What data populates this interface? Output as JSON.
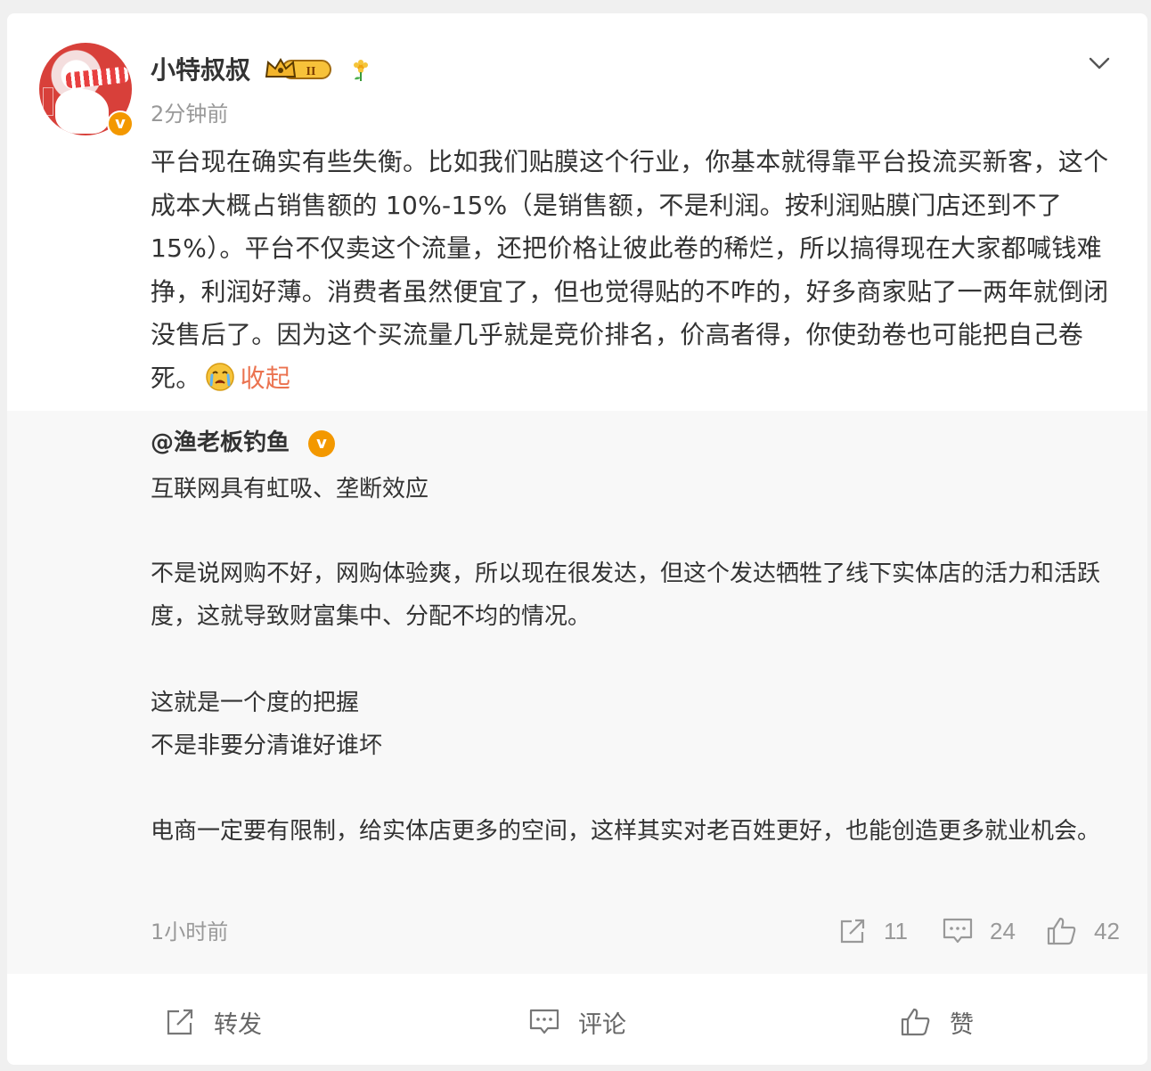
{
  "post": {
    "username": "小特叔叔",
    "rank_badge": "II",
    "time": "2分钟前",
    "text": "平台现在确实有些失衡。比如我们贴膜这个行业，你基本就得靠平台投流买新客，这个成本大概占销售额的 10%-15%（是销售额，不是利润。按利润贴膜门店还到不了 15%）。平台不仅卖这个流量，还把价格让彼此卷的稀烂，所以搞得现在大家都喊钱难挣，利润好薄。消费者虽然便宜了，但也觉得贴的不咋的，好多商家贴了一两年就倒闭没售后了。因为这个买流量几乎就是竞价排名，价高者得，你使劲卷也可能把自己卷死。",
    "collapse_label": "收起"
  },
  "quote": {
    "username": "@渔老板钓鱼",
    "lines": [
      "互联网具有虹吸、垄断效应",
      "不是说网购不好，网购体验爽，所以现在很发达，但这个发达牺牲了线下实体店的活力和活跃度，这就导致财富集中、分配不均的情况。",
      "这就是一个度的把握",
      "不是非要分清谁好谁坏",
      "电商一定要有限制，给实体店更多的空间，这样其实对老百姓更好，也能创造更多就业机会。"
    ],
    "time": "1小时前",
    "repost_count": "11",
    "comment_count": "24",
    "like_count": "42"
  },
  "actions": {
    "repost_label": "转发",
    "comment_label": "评论",
    "like_label": "赞"
  },
  "colors": {
    "accent": "#eb7350",
    "verified": "#f39800",
    "muted": "#999999"
  },
  "icons": [
    "chevron-down-icon",
    "verified-badge-icon",
    "rank-crown-icon",
    "flower-icon",
    "crying-emoji-icon",
    "repost-icon",
    "comment-icon",
    "like-icon"
  ]
}
